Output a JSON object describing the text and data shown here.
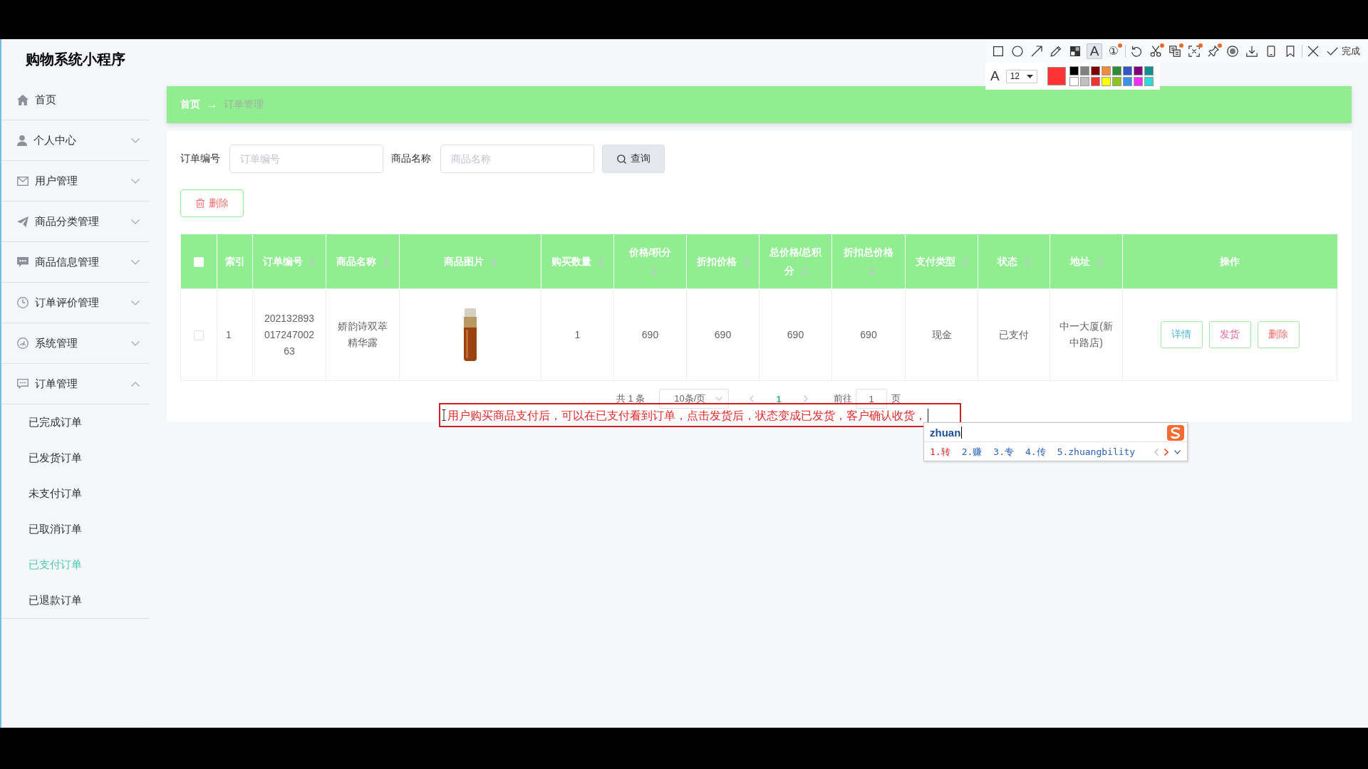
{
  "sidebar": {
    "title": "购物系统小程序",
    "items": [
      {
        "kind": "link",
        "label": "首页"
      },
      {
        "kind": "group",
        "label": "个人中心",
        "expanded": false
      },
      {
        "kind": "group",
        "label": "用户管理",
        "expanded": false
      },
      {
        "kind": "group",
        "label": "商品分类管理",
        "expanded": false
      },
      {
        "kind": "group",
        "label": "商品信息管理",
        "expanded": false
      },
      {
        "kind": "group",
        "label": "订单评价管理",
        "expanded": false
      },
      {
        "kind": "group",
        "label": "系统管理",
        "expanded": false
      },
      {
        "kind": "group",
        "label": "订单管理",
        "expanded": true,
        "children": [
          {
            "label": "已完成订单",
            "selected": false
          },
          {
            "label": "已发货订单",
            "selected": false
          },
          {
            "label": "未支付订单",
            "selected": false
          },
          {
            "label": "已取消订单",
            "selected": false
          },
          {
            "label": "已支付订单",
            "selected": true
          },
          {
            "label": "已退款订单",
            "selected": false
          }
        ]
      }
    ]
  },
  "capture_toolbar": {
    "tool_groups": [
      [
        {
          "kind": "rectangle",
          "selected": false,
          "badge": false
        },
        {
          "kind": "ellipse",
          "selected": false,
          "badge": false
        },
        {
          "kind": "arrow",
          "selected": false,
          "badge": false
        },
        {
          "kind": "pencil",
          "selected": false,
          "badge": false
        },
        {
          "kind": "mosaic",
          "selected": false,
          "badge": false
        },
        {
          "kind": "text",
          "label": "A",
          "selected": true,
          "badge": false
        },
        {
          "kind": "number",
          "label": "①",
          "selected": false,
          "badge": true
        }
      ],
      [
        {
          "kind": "undo",
          "badge": false
        },
        {
          "kind": "cut",
          "badge": true
        },
        {
          "kind": "translate",
          "badge": true
        },
        {
          "kind": "ocr",
          "badge": true
        },
        {
          "kind": "pin",
          "badge": true
        },
        {
          "kind": "record",
          "badge": false
        },
        {
          "kind": "download",
          "badge": false
        },
        {
          "kind": "device",
          "badge": false
        },
        {
          "kind": "bookmark",
          "badge": false
        }
      ],
      [
        {
          "kind": "close"
        },
        {
          "kind": "done",
          "label": "完成"
        }
      ]
    ],
    "font_label": "A",
    "font_size": "12",
    "current_swatch": {
      "color": "#ff3333"
    },
    "palette": [
      {
        "color": "#000000"
      },
      {
        "color": "#808080"
      },
      {
        "color": "#800000"
      },
      {
        "color": "#f08a3c"
      },
      {
        "color": "#2e8b37"
      },
      {
        "color": "#3355cc"
      },
      {
        "color": "#800080"
      },
      {
        "color": "#108f8f"
      },
      {
        "color": "#ffffff"
      },
      {
        "color": "#c0c0c0"
      },
      {
        "color": "#ee3333"
      },
      {
        "color": "#ffff00"
      },
      {
        "color": "#8ac41c"
      },
      {
        "color": "#3a92e6"
      },
      {
        "color": "#f030f0"
      },
      {
        "color": "#30d8d8"
      }
    ]
  },
  "breadcrumb": {
    "separator": "→",
    "items": [
      {
        "label": "首页",
        "current": false
      },
      {
        "label": "订单管理",
        "current": true
      }
    ]
  },
  "search": {
    "fields": [
      {
        "label": "订单编号",
        "placeholder": "订单编号"
      },
      {
        "label": "商品名称",
        "placeholder": "商品名称"
      }
    ],
    "button": "查询"
  },
  "delete_button": "删除",
  "table": {
    "select_all": {
      "checked": false
    },
    "columns": [
      {
        "label": "索引",
        "sortable": false
      },
      {
        "label": "订单编号",
        "sortable": true
      },
      {
        "label": "商品名称",
        "sortable": true
      },
      {
        "label": "商品图片",
        "sortable": true
      },
      {
        "label": "购买数量",
        "sortable": true
      },
      {
        "label": "价格/积分",
        "sortable": true
      },
      {
        "label": "折扣价格",
        "sortable": true
      },
      {
        "label": "总价格/总积分",
        "sortable": true
      },
      {
        "label": "折扣总价格",
        "sortable": true
      },
      {
        "label": "支付类型",
        "sortable": true
      },
      {
        "label": "状态",
        "sortable": true
      },
      {
        "label": "地址",
        "sortable": true
      },
      {
        "label": "操作",
        "sortable": false
      }
    ],
    "rows": [
      {
        "checked": false,
        "cells": [
          {
            "kind": "text",
            "text": "1"
          },
          {
            "kind": "text",
            "text": "20213289301724700263"
          },
          {
            "kind": "text",
            "text": "娇韵诗双萃精华露"
          },
          {
            "kind": "image"
          },
          {
            "kind": "text",
            "text": "1"
          },
          {
            "kind": "text",
            "text": "690"
          },
          {
            "kind": "text",
            "text": "690"
          },
          {
            "kind": "text",
            "text": "690"
          },
          {
            "kind": "text",
            "text": "690"
          },
          {
            "kind": "text",
            "text": "现金"
          },
          {
            "kind": "text",
            "text": "已支付"
          },
          {
            "kind": "text",
            "text": "中一大厦(新中路店)"
          },
          {
            "kind": "actions",
            "buttons": [
              {
                "kind": "detail",
                "label": "详情"
              },
              {
                "kind": "ship",
                "label": "发货"
              },
              {
                "kind": "delete",
                "label": "删除"
              }
            ]
          }
        ]
      }
    ]
  },
  "pagination": {
    "total": "共 1 条",
    "page_size": "10条/页",
    "prev_disabled": true,
    "pages": [
      {
        "label": "1",
        "selected": true
      }
    ],
    "next_disabled": true,
    "goto_label": "前往",
    "goto_value": "1",
    "goto_unit": "页"
  },
  "annotation": {
    "text": "用户购买商品支付后，可以在已支付看到订单，点击发货后，状态变成已发货，客户确认收货，"
  },
  "ime": {
    "composition": "zhuan",
    "candidates": [
      {
        "label": "1.转",
        "selected": true
      },
      {
        "label": "2.赚",
        "selected": false
      },
      {
        "label": "3.专",
        "selected": false
      },
      {
        "label": "4.传",
        "selected": false
      },
      {
        "label": "5.zhuangbility",
        "selected": false
      }
    ],
    "prev_disabled": true,
    "next_disabled": false
  }
}
